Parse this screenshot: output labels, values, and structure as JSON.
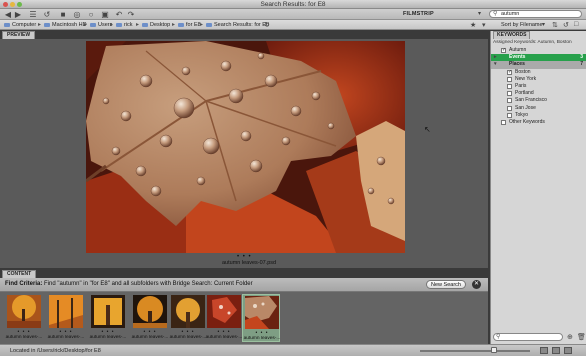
{
  "window": {
    "title": "Search Results: for E8"
  },
  "toolbar": {
    "workspace": "FILMSTRIP",
    "search_value": "autumn",
    "search_placeholder": ""
  },
  "pathbar": {
    "crumbs": [
      "Computer",
      "Macintosh HD",
      "Users",
      "rick",
      "Desktop",
      "for E8",
      "Search Results: for E8"
    ],
    "sort_label": "Sort by Filename"
  },
  "preview": {
    "tab": "PREVIEW",
    "dots": "• • •",
    "caption": "autumn leaves-07.psd"
  },
  "content": {
    "tab": "CONTENT",
    "find_label": "Find Criteria:",
    "find_text": "Find \"autumn\" in \"for E8\" and all subfolders with Bridge Search: Current Folder",
    "new_search": "New Search"
  },
  "filmstrip": {
    "thumbs": [
      {
        "label": "autumn leaves-...",
        "dots": "• • •"
      },
      {
        "label": "autumn leaves-...",
        "dots": "• • •"
      },
      {
        "label": "autumn leaves-...",
        "dots": "• • •"
      },
      {
        "label": "autumn leaves-...",
        "dots": "• • •"
      },
      {
        "label": "autumn leaves-...",
        "dots": "• • •"
      },
      {
        "label": "autumn leaves-...",
        "dots": "• • •"
      },
      {
        "label": "autumn leaves-...",
        "dots": "• • •"
      }
    ],
    "selected_index": 6
  },
  "status": {
    "text": "Located in /Users/rick/Desktop/for E8"
  },
  "keywords": {
    "tab": "KEYWORDS",
    "assigned": "Assigned Keywords: Autumn, Boston",
    "items": [
      {
        "label": "Autumn",
        "kind": "item",
        "checked": true,
        "indent": 1
      },
      {
        "label": "Events",
        "kind": "highlight",
        "count": "3",
        "indent": 0
      },
      {
        "label": "Places",
        "kind": "category",
        "count": "7",
        "indent": 0
      },
      {
        "label": "Boston",
        "kind": "item",
        "checked": true,
        "indent": 1
      },
      {
        "label": "New York",
        "kind": "item",
        "checked": false,
        "indent": 1
      },
      {
        "label": "Paris",
        "kind": "item",
        "checked": false,
        "indent": 1
      },
      {
        "label": "Portland",
        "kind": "item",
        "checked": false,
        "indent": 1
      },
      {
        "label": "San Francisco",
        "kind": "item",
        "checked": false,
        "indent": 1
      },
      {
        "label": "San Jose",
        "kind": "item",
        "checked": false,
        "indent": 1
      },
      {
        "label": "Tokyo",
        "kind": "item",
        "checked": false,
        "indent": 1
      },
      {
        "label": "Other Keywords",
        "kind": "item",
        "checked": false,
        "indent": 0
      }
    ]
  },
  "colors": {
    "accent_green": "#27a04b",
    "panel_bg": "#d6d6d6",
    "preview_bg": "#5a5a5a"
  }
}
